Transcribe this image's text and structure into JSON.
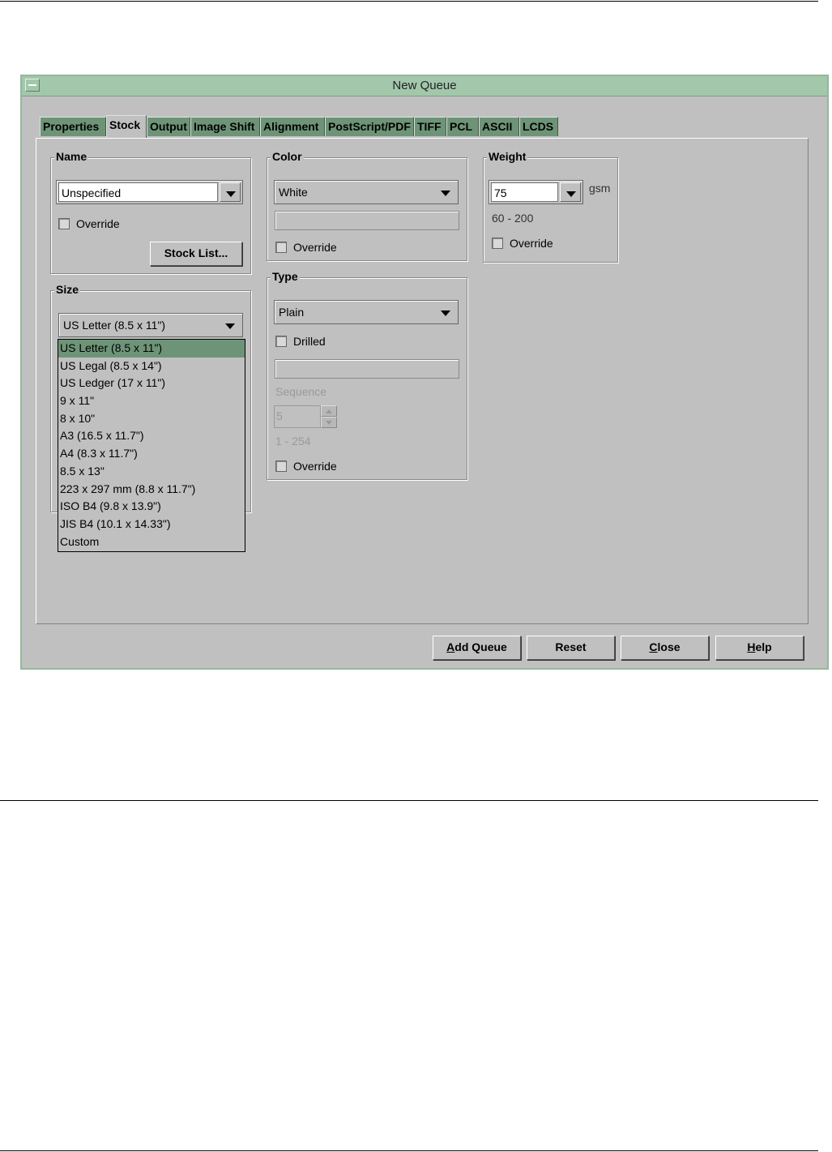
{
  "window": {
    "title": "New Queue"
  },
  "tabs": [
    {
      "label": "Properties"
    },
    {
      "label": "Stock"
    },
    {
      "label": "Output"
    },
    {
      "label": "Image Shift"
    },
    {
      "label": "Alignment"
    },
    {
      "label": "PostScript/PDF"
    },
    {
      "label": "TIFF"
    },
    {
      "label": "PCL"
    },
    {
      "label": "ASCII"
    },
    {
      "label": "LCDS"
    }
  ],
  "name_group": {
    "legend": "Name",
    "value": "Unspecified",
    "override_label": "Override",
    "stock_list_button": "Stock List..."
  },
  "size_group": {
    "legend": "Size",
    "value": "US Letter (8.5 x 11\")",
    "options": [
      "US Letter (8.5 x 11\")",
      "US Legal (8.5 x 14\")",
      "US Ledger (17 x 11\")",
      "9 x 11\"",
      "8 x 10\"",
      "A3 (16.5 x 11.7\")",
      "A4 (8.3 x 11.7\")",
      "8.5 x 13\"",
      "223 x 297 mm (8.8 x 11.7\")",
      "ISO B4 (9.8 x 13.9\")",
      "JIS B4 (10.1 x 14.33\")",
      "Custom"
    ]
  },
  "color_group": {
    "legend": "Color",
    "value": "White",
    "override_label": "Override"
  },
  "type_group": {
    "legend": "Type",
    "value": "Plain",
    "drilled_label": "Drilled",
    "sequence_label": "Sequence",
    "sequence_value": "5",
    "sequence_range": "1 - 254",
    "override_label": "Override"
  },
  "weight_group": {
    "legend": "Weight",
    "value": "75",
    "unit": "gsm",
    "range": "60 - 200",
    "override_label": "Override"
  },
  "footer": {
    "add_queue": {
      "underline": "A",
      "rest": "dd Queue"
    },
    "reset": "Reset",
    "close": {
      "underline": "C",
      "rest": "lose"
    },
    "help": {
      "underline": "H",
      "rest": "elp"
    }
  },
  "colors": {
    "titlebar": "#a3c7ab",
    "tab": "#6e9478",
    "face": "#c0c0c0",
    "selection": "#6e9478"
  }
}
